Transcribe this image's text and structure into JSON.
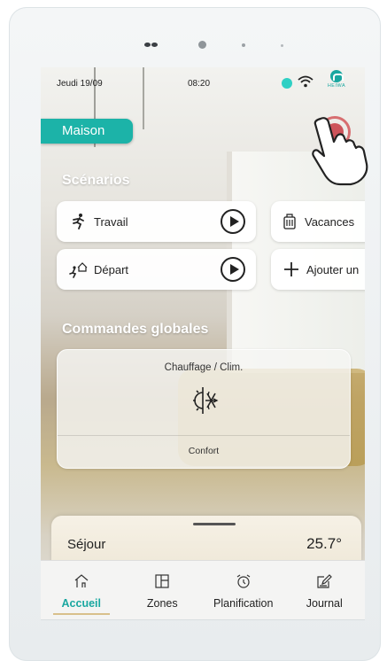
{
  "status_bar": {
    "date": "Jeudi 19/09",
    "time": "08:20",
    "brand": "HEIWA",
    "status_dot_color": "#2fd0c4"
  },
  "home": {
    "label": "Maison"
  },
  "sections": {
    "scenarios_title": "Scénarios",
    "global_title": "Commandes globales"
  },
  "scenarios": [
    {
      "label": "Travail",
      "icon": "running-person-icon"
    },
    {
      "label": "Vacances",
      "icon": "suitcase-icon"
    },
    {
      "label": "Départ",
      "icon": "leaving-home-icon"
    },
    {
      "label": "Ajouter un",
      "icon": "plus-icon"
    }
  ],
  "global_command": {
    "title": "Chauffage / Clim.",
    "icon": "sun-snowflake-icon",
    "mode": "Confort"
  },
  "room": {
    "name": "Séjour",
    "temperature": "25.7°"
  },
  "nav": [
    {
      "label": "Accueil",
      "icon": "home-icon",
      "active": true
    },
    {
      "label": "Zones",
      "icon": "zones-icon",
      "active": false
    },
    {
      "label": "Planification",
      "icon": "alarm-clock-icon",
      "active": false
    },
    {
      "label": "Journal",
      "icon": "journal-icon",
      "active": false
    }
  ],
  "colors": {
    "accent": "#1cb3a8",
    "settings": "#c9434a"
  }
}
